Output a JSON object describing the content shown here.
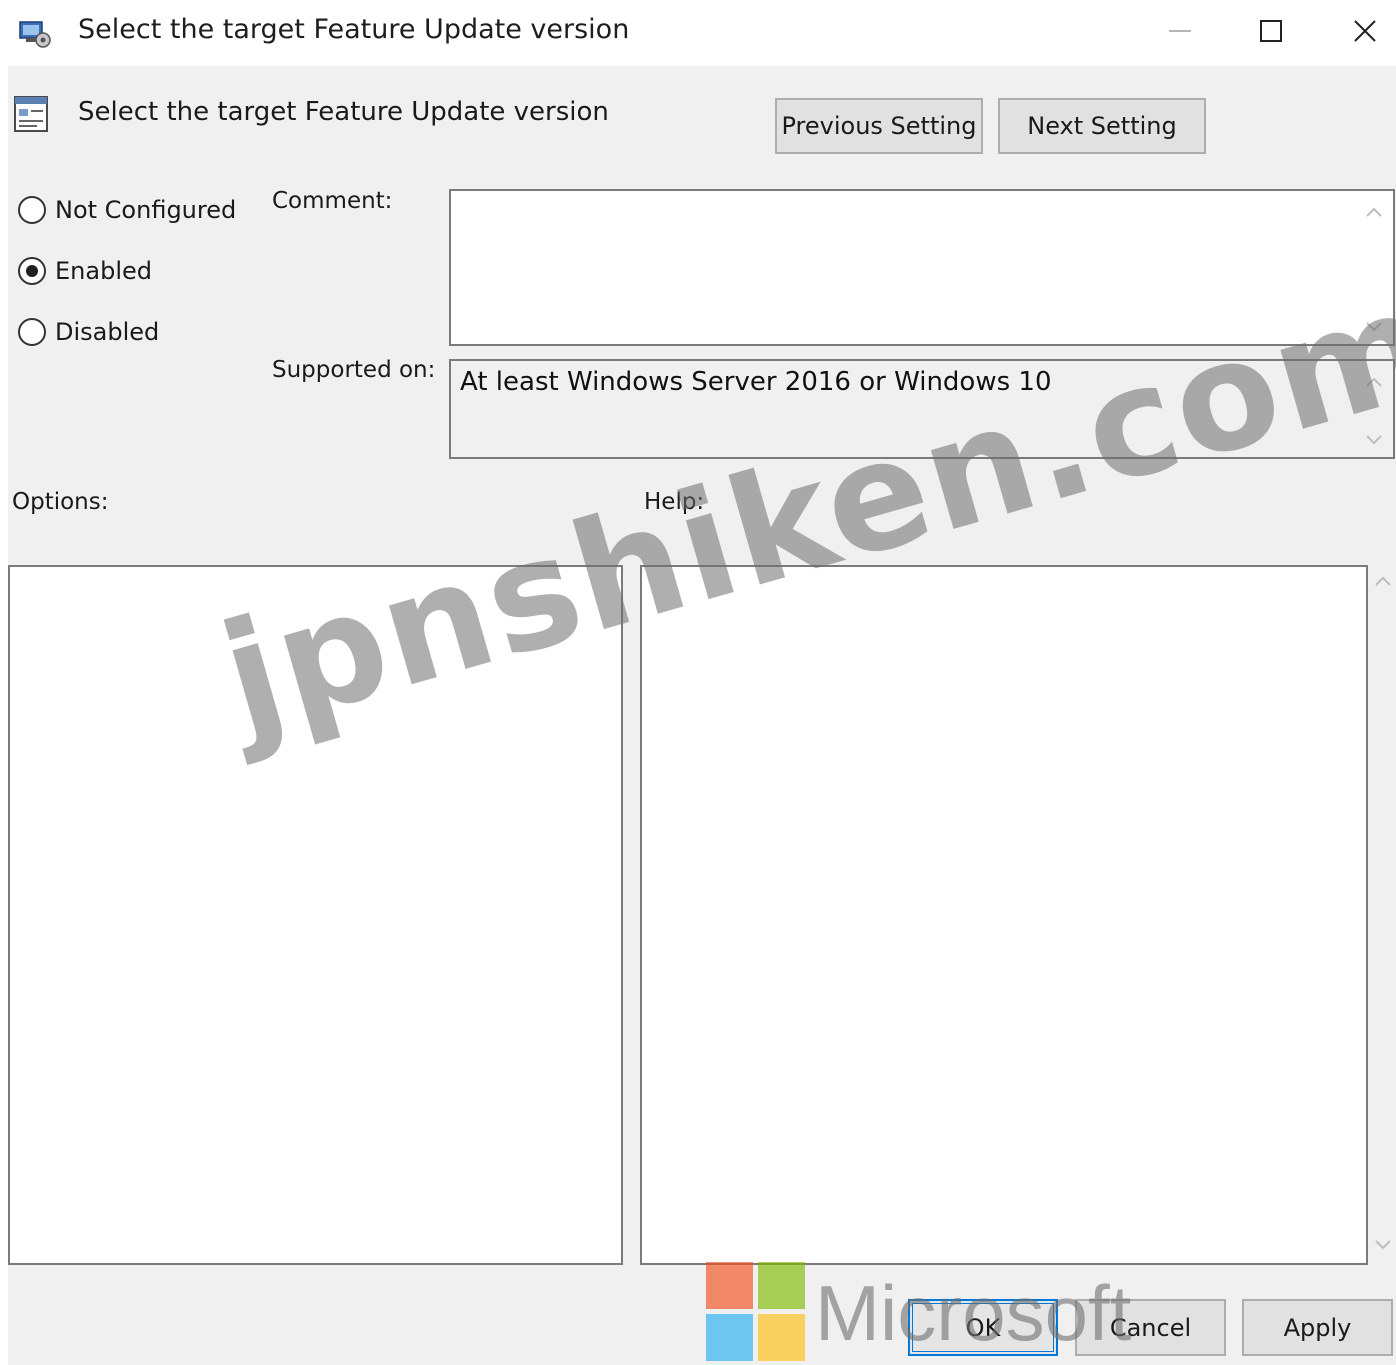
{
  "window": {
    "title": "Select the target Feature Update version",
    "controls": {
      "minimize": "—",
      "maximize": "☐",
      "close": "✕"
    }
  },
  "header": {
    "policy_title": "Select the target Feature Update version",
    "previous_label": "Previous Setting",
    "next_label": "Next Setting"
  },
  "state": {
    "options": [
      {
        "label": "Not Configured",
        "checked": false
      },
      {
        "label": "Enabled",
        "checked": true
      },
      {
        "label": "Disabled",
        "checked": false
      }
    ]
  },
  "comment": {
    "label": "Comment:",
    "value": ""
  },
  "supported": {
    "label": "Supported on:",
    "value": "At least Windows Server 2016 or Windows 10"
  },
  "panels": {
    "options_label": "Options:",
    "help_label": "Help:"
  },
  "footer": {
    "ok_label": "OK",
    "cancel_label": "Cancel",
    "apply_label": "Apply"
  },
  "watermarks": {
    "site": "jpnshiken.com",
    "brand": "Microsoft"
  },
  "colors": {
    "dialog_bg": "#f0f0f0",
    "focus_border": "#0078d7",
    "button_bg": "#e1e1e1"
  }
}
